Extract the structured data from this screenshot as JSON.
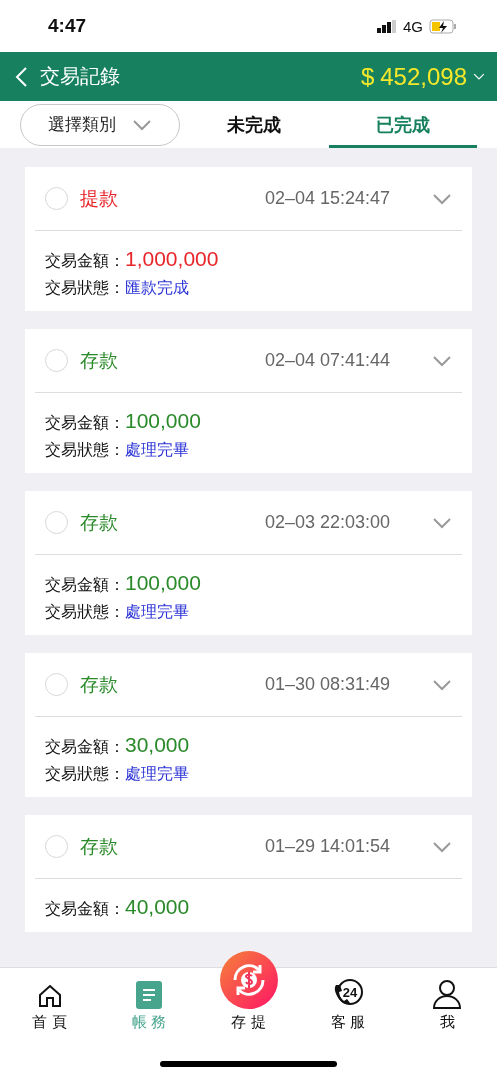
{
  "status_bar": {
    "time": "4:47",
    "network": "4G"
  },
  "header": {
    "title": "交易記錄",
    "balance_symbol": "$",
    "balance": "452,098"
  },
  "filter": {
    "label": "選擇類別"
  },
  "tabs": [
    {
      "label": "未完成",
      "selected": false
    },
    {
      "label": "已完成",
      "selected": true
    }
  ],
  "records": [
    {
      "kind": "withdrawal",
      "type": "提款",
      "time": "02–04 15:24:47",
      "selected": false,
      "amount_label": "交易金額：",
      "amount": "1,000,000",
      "status_label": "交易狀態：",
      "status": "匯款完成"
    },
    {
      "kind": "deposit",
      "type": "存款",
      "time": "02–04 07:41:44",
      "selected": false,
      "amount_label": "交易金額：",
      "amount": "100,000",
      "status_label": "交易狀態：",
      "status": "處理完畢"
    },
    {
      "kind": "deposit",
      "type": "存款",
      "time": "02–03 22:03:00",
      "selected": false,
      "amount_label": "交易金額：",
      "amount": "100,000",
      "status_label": "交易狀態：",
      "status": "處理完畢"
    },
    {
      "kind": "deposit",
      "type": "存款",
      "time": "01–30 08:31:49",
      "selected": false,
      "amount_label": "交易金額：",
      "amount": "30,000",
      "status_label": "交易狀態：",
      "status": "處理完畢"
    },
    {
      "kind": "deposit",
      "type": "存款",
      "time": "01–29 14:01:54",
      "selected": false,
      "amount_label": "交易金額：",
      "amount": "40,000"
    }
  ],
  "nav": [
    {
      "kind": "home",
      "label": "首 頁",
      "selected": false
    },
    {
      "kind": "ledger",
      "label": "帳 務",
      "selected": true
    },
    {
      "kind": "cash",
      "label": "存 提",
      "selected": false
    },
    {
      "kind": "support",
      "label": "客 服",
      "badge": "24",
      "selected": false
    },
    {
      "kind": "profile",
      "label": "我",
      "selected": false
    }
  ]
}
